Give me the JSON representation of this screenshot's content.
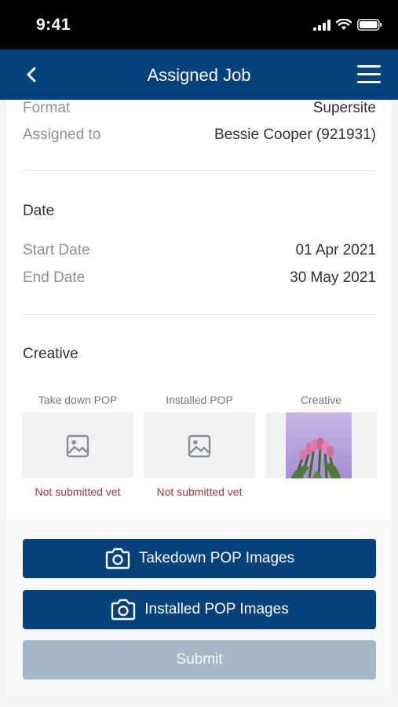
{
  "status_bar": {
    "time": "9:41"
  },
  "nav": {
    "title": "Assigned Job"
  },
  "details": {
    "format_label": "Format",
    "format_value": "Supersite",
    "assigned_label": "Assigned to",
    "assigned_value": "Bessie Cooper (921931)"
  },
  "date_section": {
    "title": "Date",
    "start_label": "Start Date",
    "start_value": "01 Apr 2021",
    "end_label": "End Date",
    "end_value": "30 May 2021"
  },
  "creative_section": {
    "title": "Creative",
    "thumbs": [
      {
        "caption": "Take down POP",
        "status": "Not submitted vet",
        "icon": "image-placeholder-icon"
      },
      {
        "caption": "Installed POP",
        "status": "Not submitted vet",
        "icon": "image-placeholder-icon"
      },
      {
        "caption": "Creative",
        "status": ""
      }
    ]
  },
  "buttons": {
    "takedown": "Takedown POP Images",
    "installed": "Installed POP Images",
    "submit": "Submit"
  },
  "colors": {
    "primary": "#05417c",
    "disabled": "#a6b7c8",
    "error_text": "#a33a3a"
  }
}
